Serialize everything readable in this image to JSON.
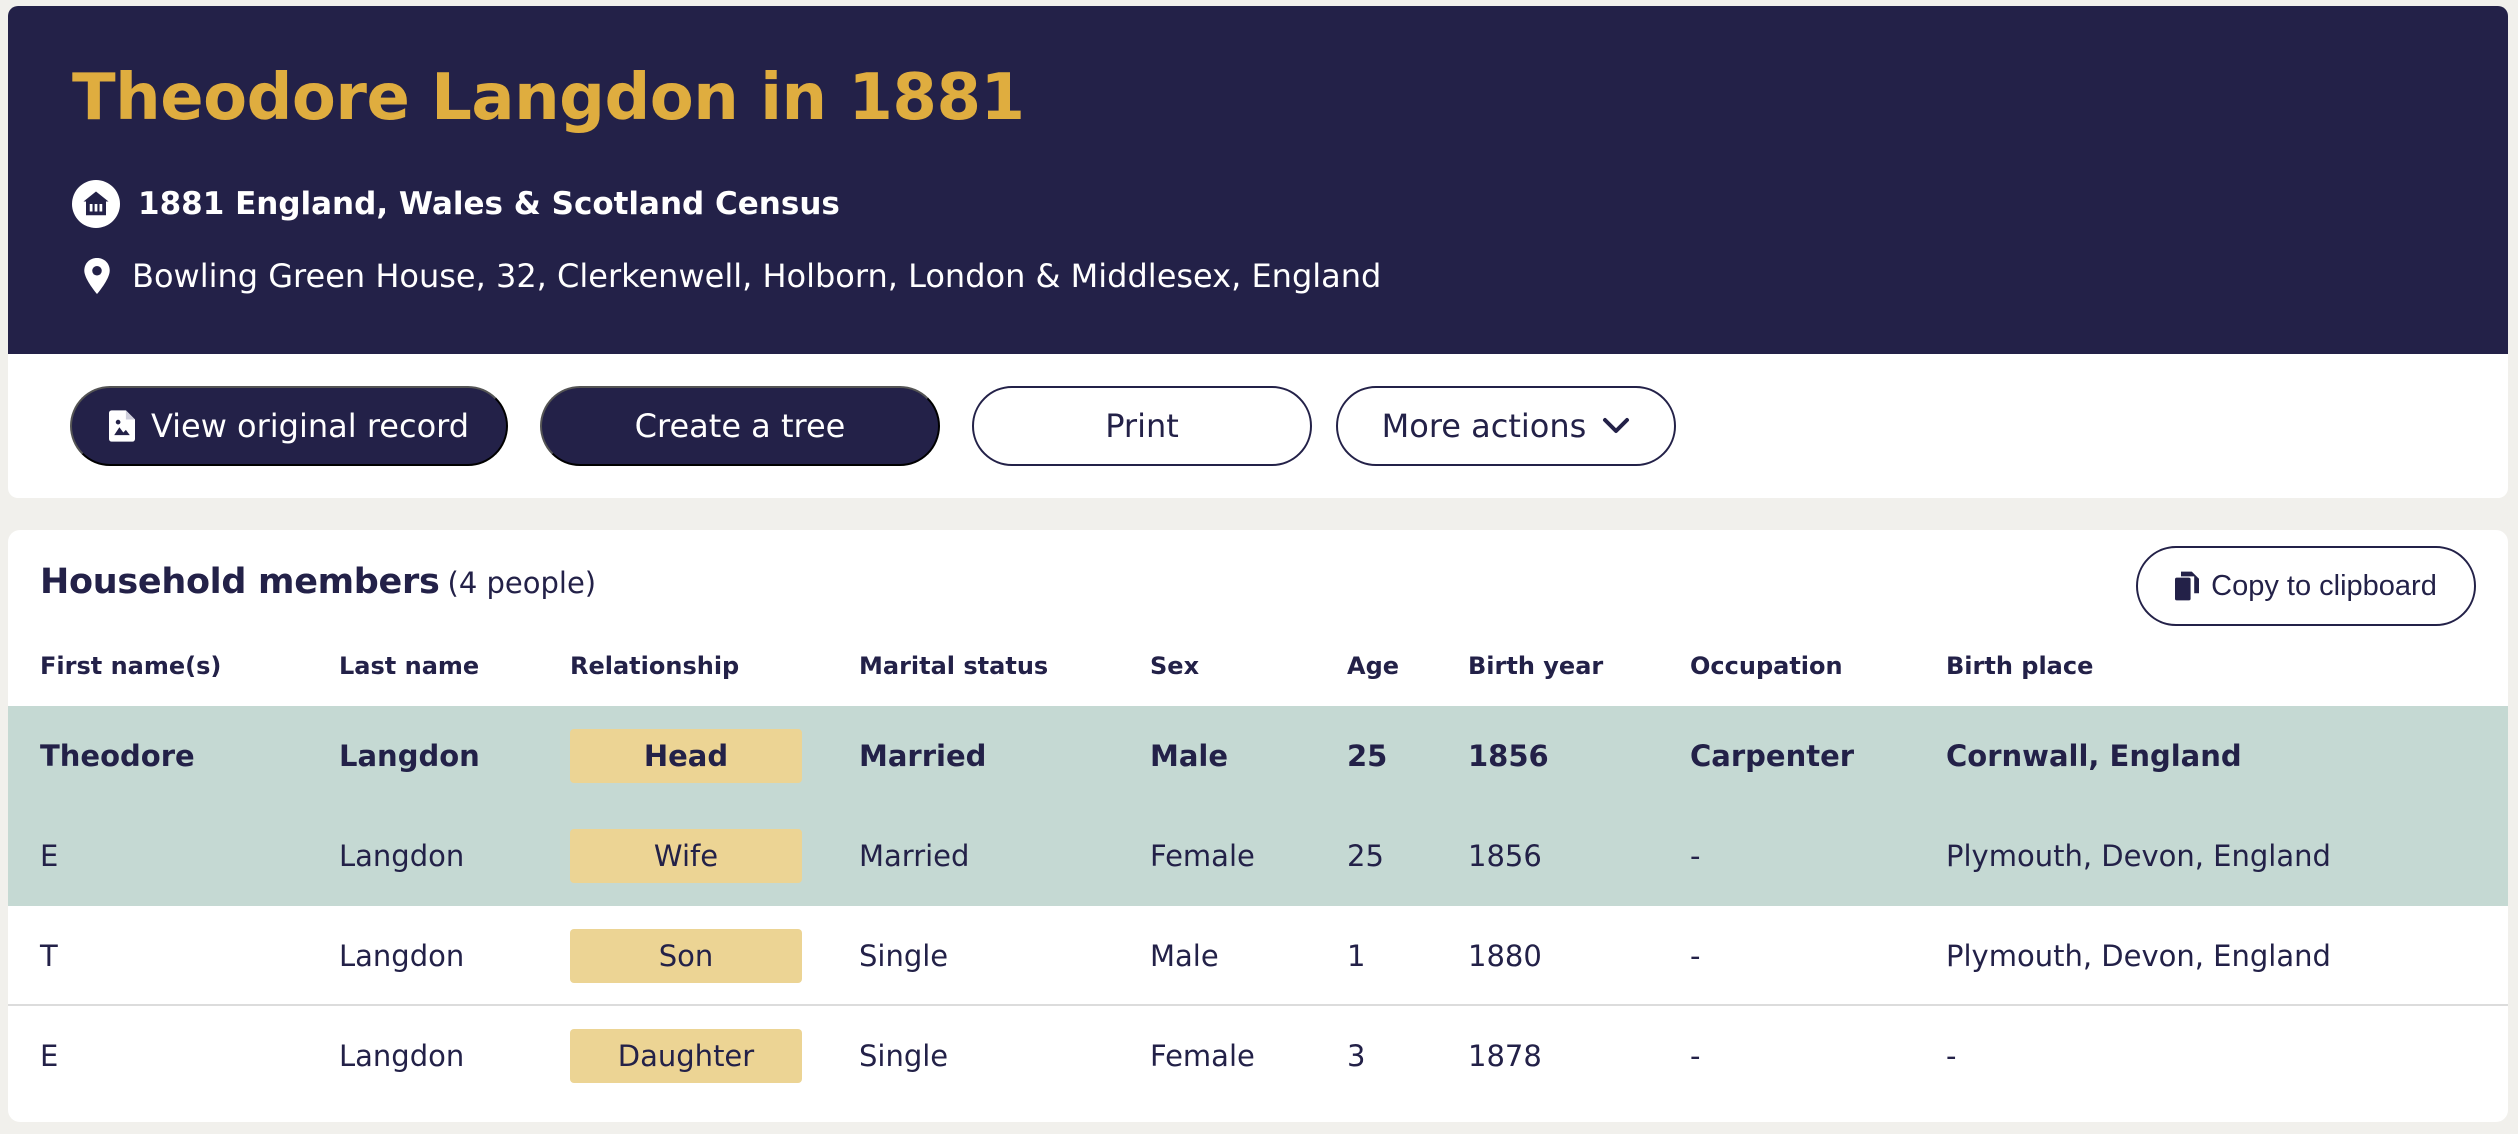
{
  "header": {
    "title": "Theodore Langdon in 1881",
    "census": "1881 England, Wales & Scotland Census",
    "location": "Bowling Green House, 32, Clerkenwell, Holborn, London & Middlesex, England",
    "census_icon": "house-icon",
    "location_icon": "map-pin-icon"
  },
  "actions": {
    "view_original": "View original record",
    "create_tree": "Create a tree",
    "print": "Print",
    "more_actions": "More actions"
  },
  "household": {
    "title": "Household members",
    "count": "(4 people)",
    "copy_label": "Copy to clipboard",
    "columns": [
      "First name(s)",
      "Last name",
      "Relationship",
      "Marital status",
      "Sex",
      "Age",
      "Birth year",
      "Occupation",
      "Birth place"
    ],
    "rows": [
      [
        "Theodore",
        "Langdon",
        "Head",
        "Married",
        "Male",
        "25",
        "1856",
        "Carpenter",
        "Cornwall, England"
      ],
      [
        "E",
        "Langdon",
        "Wife",
        "Married",
        "Female",
        "25",
        "1856",
        "-",
        "Plymouth, Devon, England"
      ],
      [
        "T",
        "Langdon",
        "Son",
        "Single",
        "Male",
        "1",
        "1880",
        "-",
        "Plymouth, Devon, England"
      ],
      [
        "E",
        "Langdon",
        "Daughter",
        "Single",
        "Female",
        "3",
        "1878",
        "-",
        "-"
      ]
    ]
  },
  "colors": {
    "navy": "#232148",
    "gold": "#dfad3f",
    "highlight_row": "#c5d9d3",
    "relationship_badge": "#ecd494",
    "page_background": "#f1f0ec"
  }
}
